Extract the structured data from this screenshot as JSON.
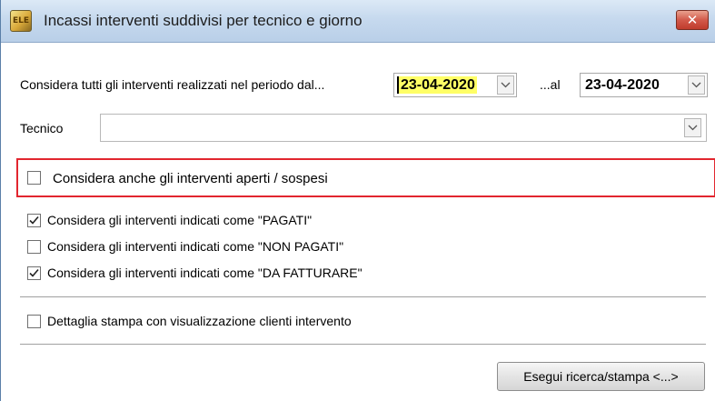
{
  "window": {
    "title": "Incassi interventi suddivisi per tecnico e giorno",
    "app_icon_text": "ELE",
    "close_label": "✕"
  },
  "period": {
    "label_from": "Considera tutti gli interventi realizzati nel periodo dal...",
    "date_from": "23-04-2020",
    "label_to": "...al",
    "date_to": "23-04-2020"
  },
  "technician": {
    "label": "Tecnico",
    "value": ""
  },
  "options": {
    "open_suspended": {
      "label": "Considera anche gli interventi aperti / sospesi",
      "checked": false
    },
    "paid": {
      "label": "Considera gli interventi indicati come \"PAGATI\"",
      "checked": true
    },
    "unpaid": {
      "label": "Considera gli interventi indicati come \"NON PAGATI\"",
      "checked": false
    },
    "to_invoice": {
      "label": "Considera gli interventi indicati come \"DA FATTURARE\"",
      "checked": true
    },
    "detail_clients": {
      "label": "Dettaglia stampa con visualizzazione clienti intervento",
      "checked": false
    }
  },
  "actions": {
    "run_label": "Esegui ricerca/stampa <...>"
  },
  "colors": {
    "highlight": "#ffff66",
    "red_frame": "#e2262f",
    "close_button": "#c03c2c"
  }
}
